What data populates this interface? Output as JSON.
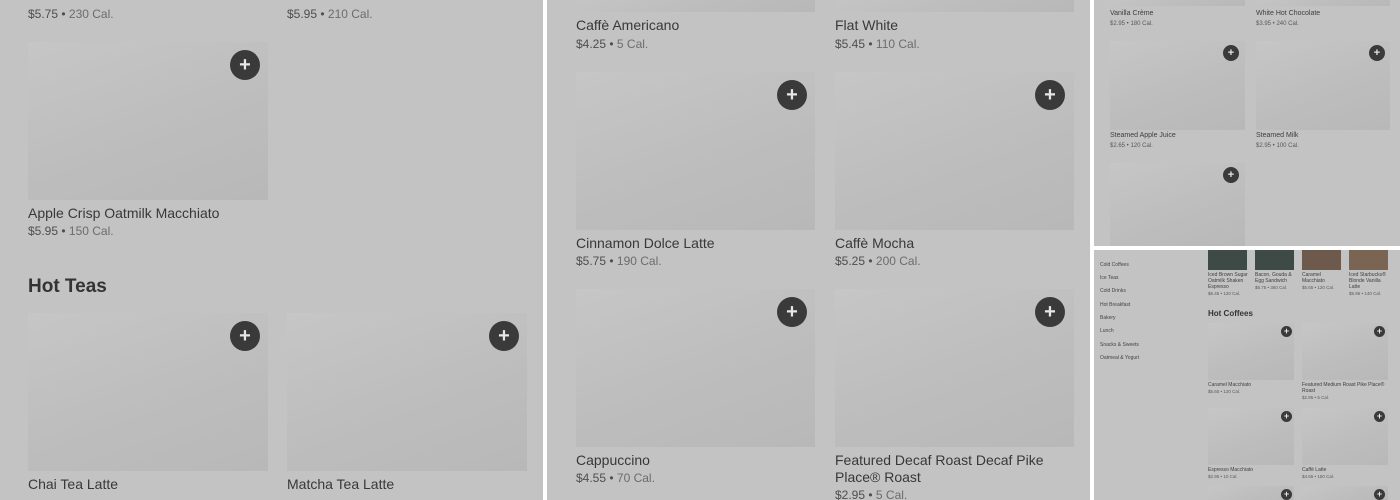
{
  "panel_a": {
    "top_items": [
      {
        "price": "$5.75",
        "cal": "230 Cal."
      },
      {
        "price": "$5.95",
        "cal": "210 Cal."
      }
    ],
    "item1": {
      "name": "Apple Crisp Oatmilk Macchiato",
      "price": "$5.95",
      "cal": "150 Cal."
    },
    "section_title": "Hot Teas",
    "tea_items": [
      {
        "name": "Chai Tea Latte"
      },
      {
        "name": "Matcha Tea Latte"
      }
    ],
    "add_label": "+"
  },
  "panel_b": {
    "items": [
      {
        "name": "Caffè Americano",
        "price": "$4.25",
        "cal": "5 Cal."
      },
      {
        "name": "Flat White",
        "price": "$5.45",
        "cal": "110 Cal."
      },
      {
        "name": "Cinnamon Dolce Latte",
        "price": "$5.75",
        "cal": "190 Cal."
      },
      {
        "name": "Caffè Mocha",
        "price": "$5.25",
        "cal": "200 Cal."
      },
      {
        "name": "Cappuccino",
        "price": "$4.55",
        "cal": "70 Cal."
      },
      {
        "name": "Featured Decaf Roast Decaf Pike Place® Roast",
        "price": "$2.95",
        "cal": "5 Cal."
      }
    ],
    "separator": "•",
    "add_label": "+"
  },
  "panel_c": {
    "items": [
      {
        "name": "Vanilla Crème",
        "price": "$2.95",
        "cal": "180 Cal."
      },
      {
        "name": "White Hot Chocolate",
        "price": "$3.95",
        "cal": "240 Cal."
      },
      {
        "name": "Steamed Apple Juice",
        "price": "$2.65",
        "cal": "120 Cal."
      },
      {
        "name": "Steamed Milk",
        "price": "$2.95",
        "cal": "100 Cal."
      }
    ],
    "add_label": "+"
  },
  "panel_d": {
    "nav": [
      "Cold Coffees",
      "Ice Teas",
      "Cold Drinks",
      "Hot Breakfast",
      "Bakery",
      "Lunch",
      "Snacks & Sweets",
      "Oatmeal & Yogurt"
    ],
    "featured": [
      {
        "name": "Iced Brown Sugar Oatmilk Shaken Espresso",
        "price": "$6.45",
        "cal": "120 Cal."
      },
      {
        "name": "Bacon, Gouda & Egg Sandwich",
        "price": "$5.75",
        "cal": "360 Cal."
      },
      {
        "name": "Caramel Macchiato",
        "price": "$5.65",
        "cal": "120 Cal."
      },
      {
        "name": "Iced Starbucks® Blonde Vanilla Latte",
        "price": "$5.95",
        "cal": "140 Cal."
      }
    ],
    "section_title": "Hot Coffees",
    "items": [
      {
        "name": "Caramel Macchiato",
        "price": "$5.65",
        "cal": "120 Cal."
      },
      {
        "name": "Featured Medium Roast Pike Place® Roast",
        "price": "$2.95",
        "cal": "5 Cal."
      },
      {
        "name": "Espresso Macchiato",
        "price": "$2.95",
        "cal": "10 Cal."
      },
      {
        "name": "Caffè Latte",
        "price": "$4.65",
        "cal": "150 Cal."
      }
    ],
    "add_label": "+"
  },
  "colors": {
    "overlay": "#c3c3c3",
    "button": "#3a3a3a",
    "image": "#bdbdbd"
  }
}
